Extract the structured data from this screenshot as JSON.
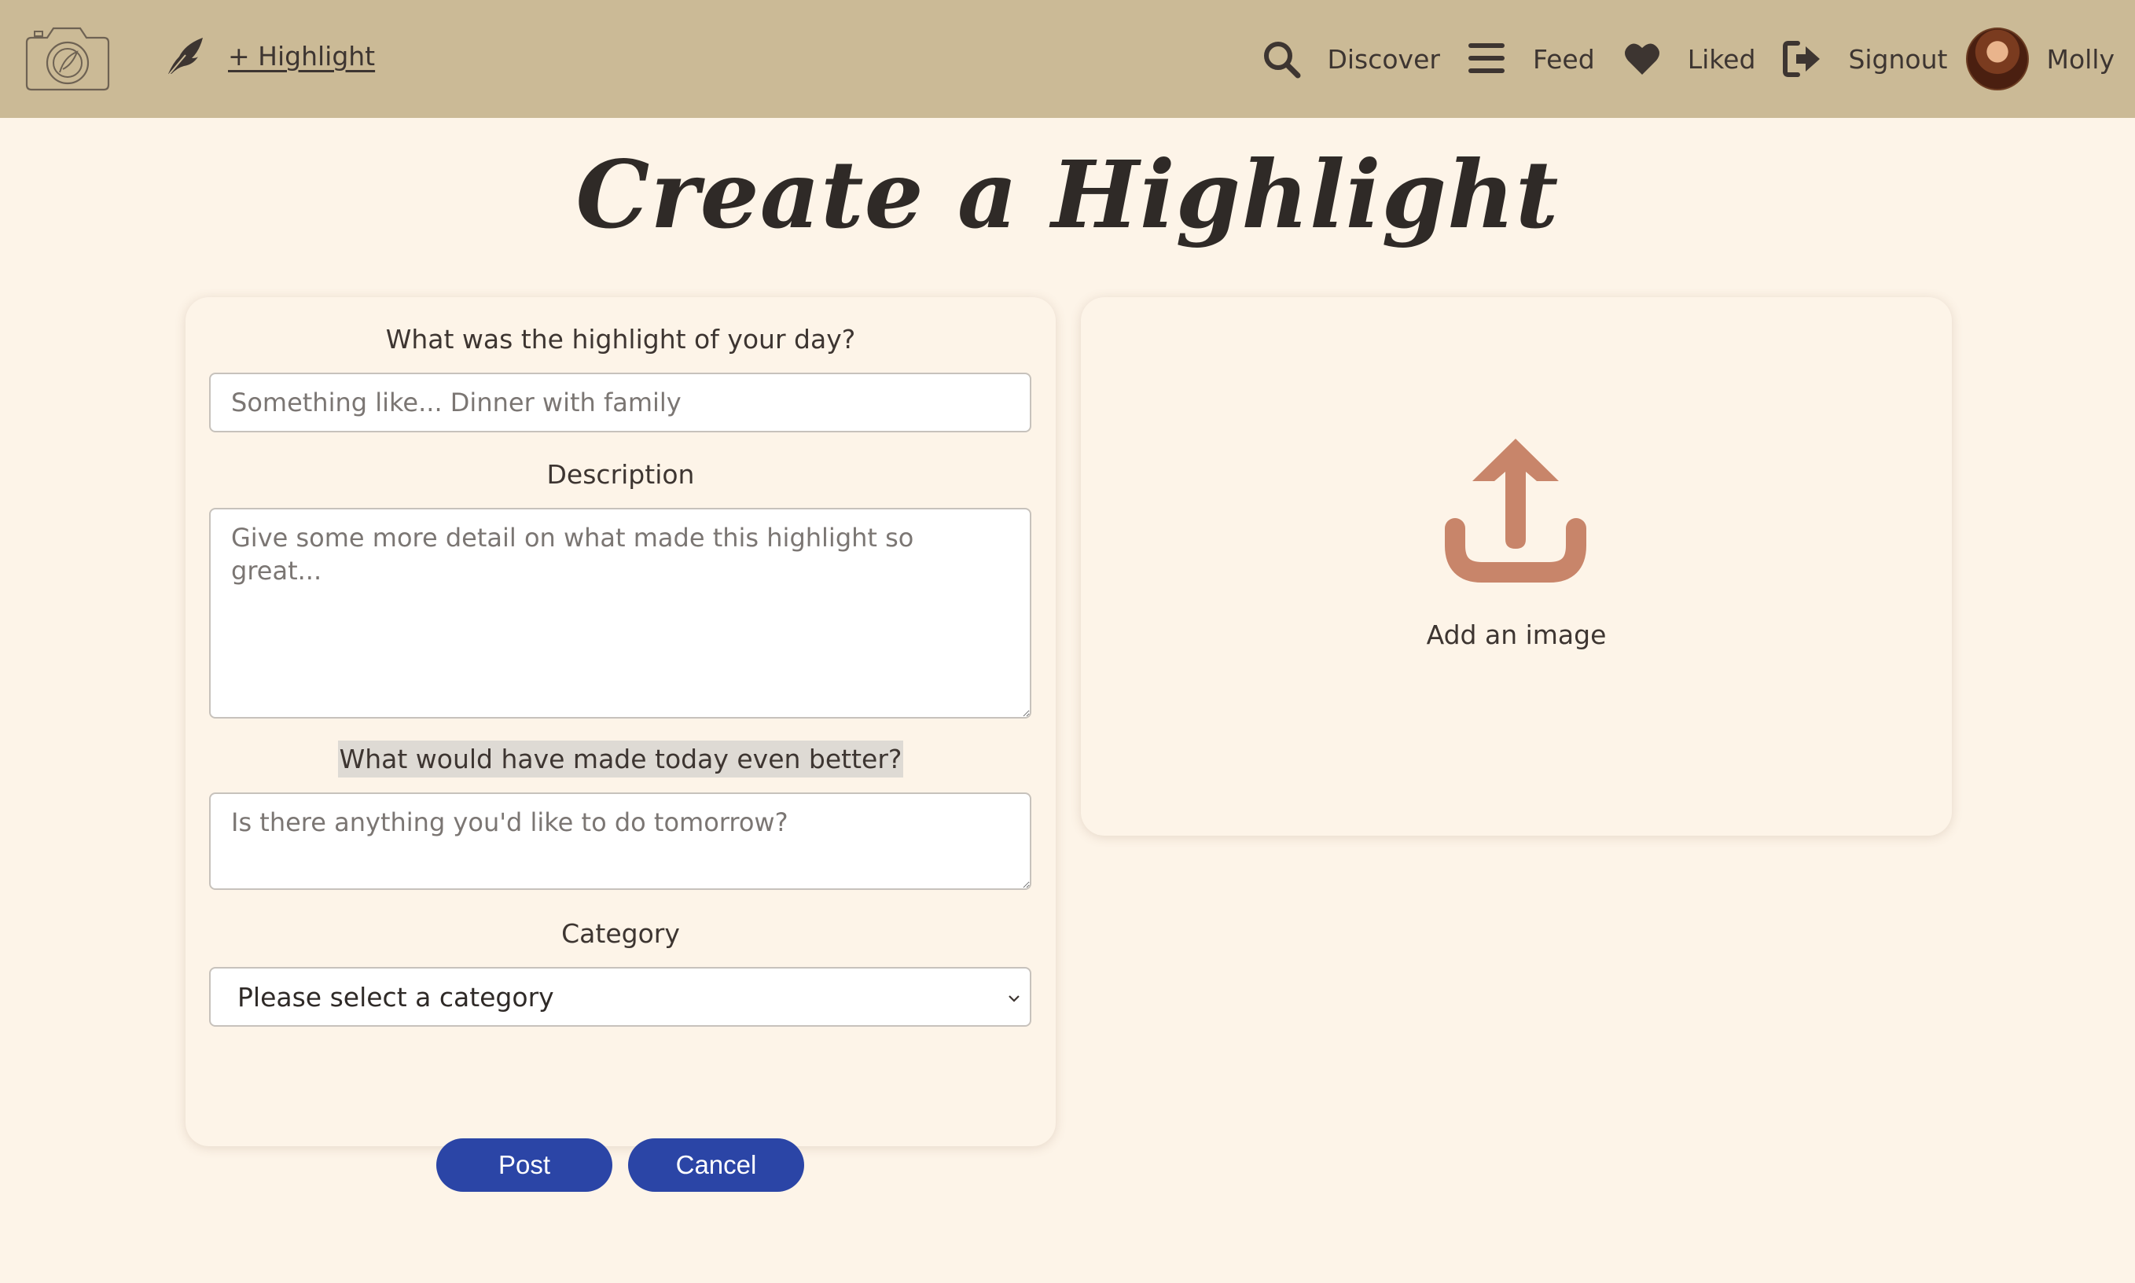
{
  "navbar": {
    "add_link": "+ Highlight",
    "items": [
      {
        "label": "Discover",
        "icon": "search-icon"
      },
      {
        "label": "Feed",
        "icon": "bars-icon"
      },
      {
        "label": "Liked",
        "icon": "heart-icon"
      },
      {
        "label": "Signout",
        "icon": "signout-icon"
      }
    ],
    "user_name": "Molly"
  },
  "page": {
    "title": "Create a Highlight"
  },
  "form": {
    "highlight_label": "What was the highlight of your day?",
    "highlight_placeholder": "Something like... Dinner with family",
    "description_label": "Description",
    "description_placeholder": "Give some more detail on what made this highlight so great...",
    "better_label": "What would have made today even better?",
    "better_placeholder": "Is there anything you'd like to do tomorrow?",
    "category_label": "Category",
    "category_selected": "Please select a category",
    "post_label": "Post",
    "cancel_label": "Cancel"
  },
  "upload": {
    "label": "Add an image"
  },
  "colors": {
    "navbar": "#cbba96",
    "background": "#fdf4e8",
    "button": "#2b45a6",
    "upload_icon": "#c8856a",
    "text": "#3d3531"
  }
}
